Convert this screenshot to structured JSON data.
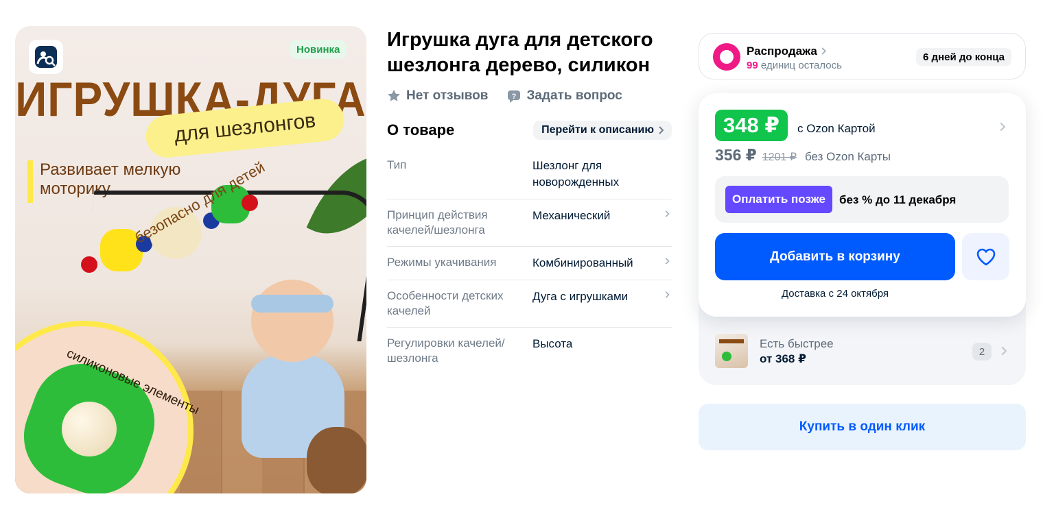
{
  "gallery": {
    "badge_new": "Новинка",
    "image_headline": "ИГРУШКА-ДУГА",
    "image_subheadline": "для шезлонгов",
    "image_benefit": "Развивает мелкую моторику",
    "image_safe": "безопасно для детей",
    "image_circle_label": "силиконовые элементы"
  },
  "product": {
    "title": "Игрушка дуга для детского шезлонга дерево, силикон",
    "reviews": "Нет отзывов",
    "ask": "Задать вопрос"
  },
  "about": {
    "title": "О товаре",
    "goto_label": "Перейти к описанию",
    "characteristics": [
      {
        "key": "Тип",
        "value": "Шезлонг для новорожденных"
      },
      {
        "key": "Принцип действия качелей/шезлонга",
        "value": "Механический"
      },
      {
        "key": "Режимы укачивания",
        "value": "Комбинированный"
      },
      {
        "key": "Особенности детских качелей",
        "value": "Дуга с игрушками"
      },
      {
        "key": "Регулировки качелей/ шезлонга",
        "value": "Высота"
      }
    ]
  },
  "sale": {
    "name": "Распродажа",
    "units_count": "99",
    "units_label": "единиц осталось",
    "ends": "6 дней до конца"
  },
  "price": {
    "card_price": "348 ₽",
    "card_label": "с Ozon Картой",
    "regular_price": "356 ₽",
    "old_price": "1201 ₽",
    "regular_label": "без Ozon Карты",
    "pay_later_button": "Оплатить позже",
    "pay_later_text": "без % до 11 декабря",
    "add_to_cart": "Добавить в корзину",
    "delivery": "Доставка с 24 октября"
  },
  "faster": {
    "label": "Есть быстрее",
    "price": "от 368 ₽",
    "count": "2"
  },
  "one_click": "Купить в один клик",
  "colors": {
    "ozon_blue": "#005bff",
    "price_green": "#10c44c",
    "sale_pink": "#ef1a86",
    "pay_later_purple": "#6349ff"
  }
}
